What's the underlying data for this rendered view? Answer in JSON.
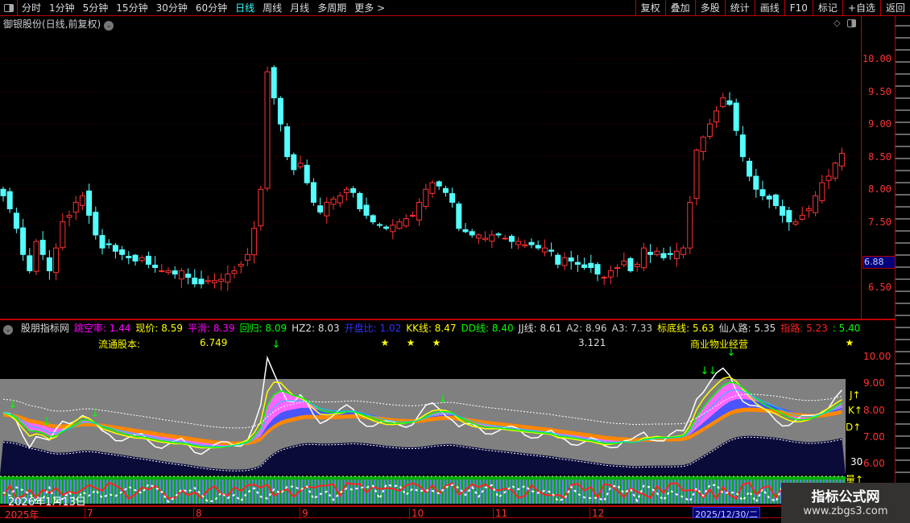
{
  "toolbar": {
    "periods": [
      "分时",
      "1分钟",
      "5分钟",
      "15分钟",
      "30分钟",
      "60分钟",
      "日线",
      "周线",
      "月线",
      "多周期",
      "更多 >"
    ],
    "active_period": "日线",
    "right_buttons": [
      "复权",
      "叠加",
      "多股",
      "统计",
      "画线",
      "F10",
      "标记",
      "+自选",
      "返回"
    ]
  },
  "stock": {
    "title": "御银股份(日线,前复权)",
    "current_price": "6.88"
  },
  "price_axis": {
    "labels": [
      "10.00",
      "9.50",
      "9.00",
      "8.50",
      "8.00",
      "7.50",
      "6.50"
    ]
  },
  "indicator": {
    "name": "股朋指标网",
    "values": [
      {
        "label": "跳空率: 1.44",
        "color": "#f0f"
      },
      {
        "label": "现价: 8.59",
        "color": "#ff0"
      },
      {
        "label": "平滑: 8.39",
        "color": "#f0f"
      },
      {
        "label": "回归: 8.09",
        "color": "#0f0"
      },
      {
        "label": "HZ2: 8.03",
        "color": "#ddd"
      },
      {
        "label": "开盘比: 1.02",
        "color": "#33f"
      },
      {
        "label": "KK线: 8.47",
        "color": "#ff0"
      },
      {
        "label": "DD线: 8.40",
        "color": "#0f0"
      },
      {
        "label": "JJ线: 8.61",
        "color": "#ddd"
      },
      {
        "label": "A2: 8.96",
        "color": "#ccc"
      },
      {
        "label": "A3: 7.33",
        "color": "#ccc"
      },
      {
        "label": "标底线: 5.63",
        "color": "#ff0"
      },
      {
        "label": "仙人路: 5.35",
        "color": "#ddd"
      },
      {
        "label": "指路: 5.23",
        "color": "#f22"
      },
      {
        "label": ": 5.40",
        "color": "#0f0"
      }
    ],
    "float_label": "流通股本:",
    "float_value": "6.749",
    "value2": "3.121",
    "industry": "商业物业经营",
    "axis_labels": [
      "10.00",
      "9.00",
      "8.00",
      "7.00",
      "6.00"
    ],
    "line_tags": [
      "J↑",
      "K↑",
      "D↑",
      "30",
      "量↑"
    ]
  },
  "date_axis": {
    "labels": [
      "2025年",
      "7",
      "8",
      "9",
      "10",
      "11",
      "12"
    ],
    "cursor_date": "2025/12/30/二",
    "hover_date": "2026年1月13日"
  },
  "watermark": {
    "line1": "指标公式网",
    "line2": "www.zbgs3.com"
  },
  "colors": {
    "up": "#ff3232",
    "down": "#54ffff",
    "axis": "#ff3232",
    "border": "#bb0000"
  },
  "chart_data": {
    "type": "candlestick",
    "ylim": [
      6.3,
      10.6
    ],
    "closes": [
      7.9,
      7.7,
      7.4,
      7.0,
      6.75,
      7.2,
      7.0,
      6.75,
      7.1,
      7.5,
      7.6,
      7.8,
      7.9,
      7.6,
      7.3,
      7.1,
      7.15,
      7.05,
      7.0,
      6.95,
      6.9,
      6.95,
      6.85,
      6.8,
      6.75,
      6.75,
      6.7,
      6.75,
      6.65,
      6.55,
      6.55,
      6.6,
      6.6,
      6.62,
      6.7,
      6.75,
      6.85,
      7.0,
      7.4,
      8.0,
      9.8,
      9.4,
      9.0,
      8.5,
      8.3,
      8.4,
      8.1,
      7.8,
      7.65,
      7.8,
      7.85,
      7.9,
      8.0,
      7.95,
      7.7,
      7.6,
      7.5,
      7.45,
      7.4,
      7.45,
      7.5,
      7.55,
      7.6,
      7.8,
      8.0,
      8.1,
      8.05,
      7.95,
      7.8,
      7.4,
      7.35,
      7.3,
      7.3,
      7.25,
      7.3,
      7.3,
      7.25,
      7.2,
      7.2,
      7.15,
      7.15,
      7.1,
      7.1,
      7.05,
      6.85,
      6.95,
      6.9,
      6.85,
      6.8,
      6.8,
      6.7,
      6.65,
      6.75,
      6.8,
      6.9,
      6.75,
      6.85,
      7.1,
      7.0,
      7.05,
      6.95,
      7.0,
      7.05,
      7.1,
      7.8,
      8.6,
      8.8,
      9.0,
      9.2,
      9.4,
      9.3,
      8.9,
      8.5,
      8.2,
      8.0,
      7.9,
      7.85,
      7.75,
      7.6,
      7.5,
      7.5,
      7.6,
      7.7,
      7.9,
      8.1,
      8.2,
      8.4,
      8.55
    ]
  }
}
